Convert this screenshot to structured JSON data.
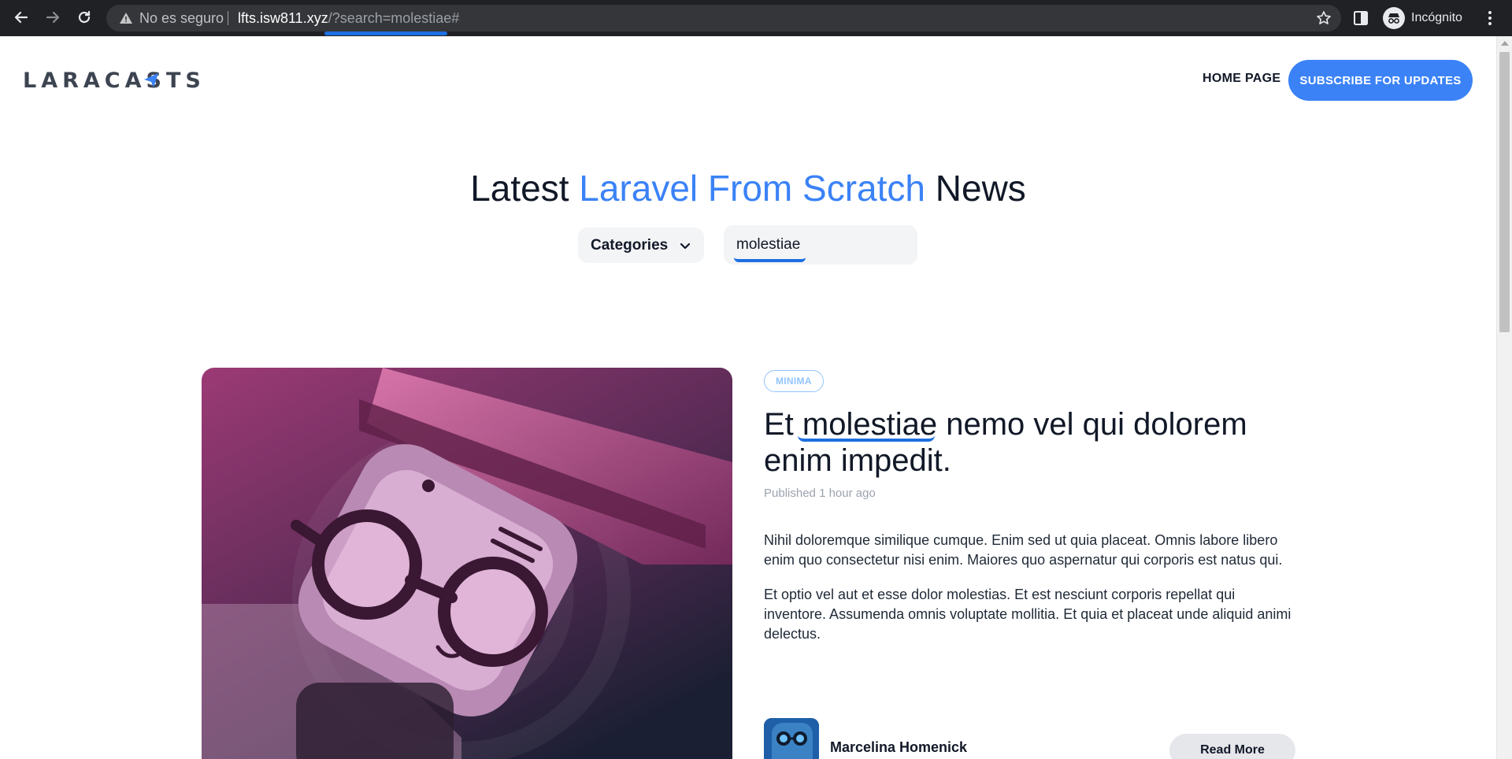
{
  "browser": {
    "security_label": "No es seguro",
    "url_host": "lfts.isw811.xyz",
    "url_path": "/?search=molestiae#",
    "profile_label": "Incógnito"
  },
  "header": {
    "logo_text": "LARACASTS",
    "nav_home": "HOME PAGE",
    "subscribe_label": "SUBSCRIBE FOR UPDATES"
  },
  "hero": {
    "title_start": "Latest ",
    "title_accent": "Laravel From Scratch",
    "title_end": " News",
    "categories_label": "Categories",
    "search_value": "molestiae"
  },
  "featured_post": {
    "category": "MINIMA",
    "title_prefix": "Et ",
    "title_highlight": "molestiae",
    "title_rest": " nemo vel qui dolorem enim impedit.",
    "published_label": "Published",
    "published_time": "1 hour ago",
    "paragraphs": [
      "Nihil doloremque similique cumque. Enim sed ut quia placeat. Omnis labore libero enim quo consectetur nisi enim. Maiores quo aspernatur qui corporis est natus qui.",
      "Et optio vel aut et esse dolor molestias. Et est nesciunt corporis repellat qui inventore. Assumenda omnis voluptate mollitia. Et quia et placeat unde aliquid animi delectus."
    ],
    "author_name": "Marcelina Homenick",
    "read_more_label": "Read More"
  },
  "colors": {
    "accent": "#3b82f6",
    "annotation": "#1d6fe0",
    "chrome": "#202124"
  },
  "icons": [
    "back-icon",
    "forward-icon",
    "reload-icon",
    "warning-icon",
    "star-icon",
    "side-panel-icon",
    "incognito-icon",
    "menu-icon",
    "chevron-down-icon"
  ]
}
